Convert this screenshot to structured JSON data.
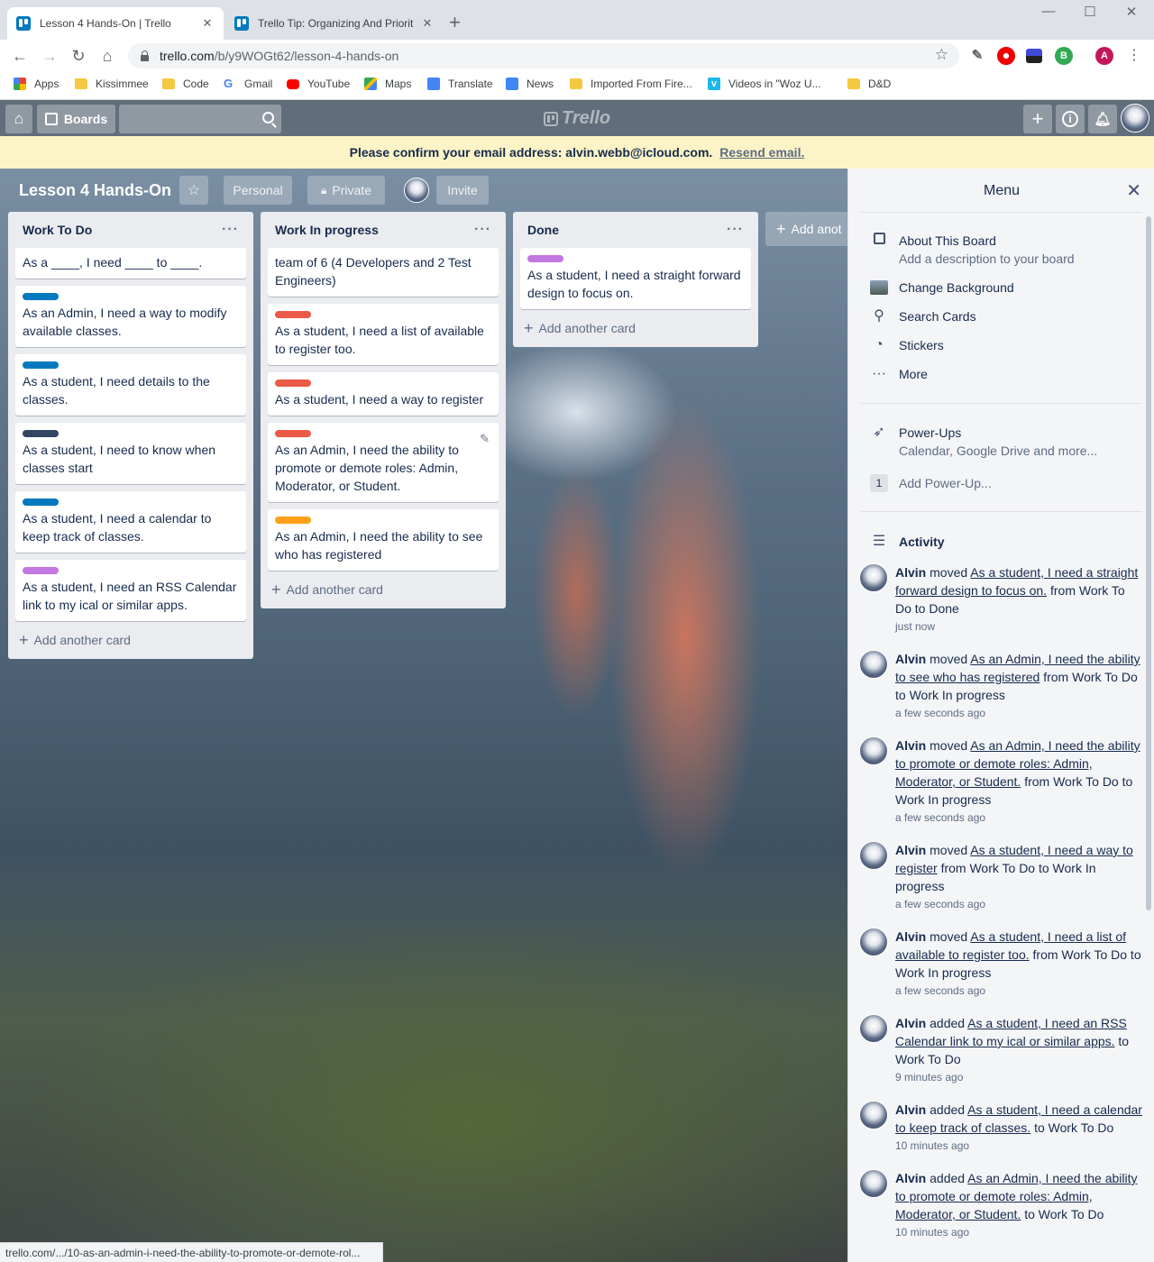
{
  "browser": {
    "tabs": [
      {
        "title": "Lesson 4 Hands-On | Trello",
        "active": true
      },
      {
        "title": "Trello Tip: Organizing And Priorit",
        "active": false
      }
    ],
    "url_domain": "trello.com",
    "url_path": "/b/y9WOGt62/lesson-4-hands-on",
    "bookmarks": [
      {
        "label": "Apps",
        "icon": "apps-grid-icon"
      },
      {
        "label": "Kissimmee",
        "icon": "folder-icon"
      },
      {
        "label": "Code",
        "icon": "folder-icon"
      },
      {
        "label": "Gmail",
        "icon": "google-icon"
      },
      {
        "label": "YouTube",
        "icon": "youtube-icon"
      },
      {
        "label": "Maps",
        "icon": "maps-icon"
      },
      {
        "label": "Translate",
        "icon": "translate-icon"
      },
      {
        "label": "News",
        "icon": "news-icon"
      },
      {
        "label": "Imported From Fire...",
        "icon": "folder-icon"
      },
      {
        "label": "Videos in \"Woz U...",
        "icon": "vimeo-icon"
      },
      {
        "label": "D&D",
        "icon": "folder-icon"
      }
    ],
    "profile_initial": "A",
    "status_url": "trello.com/.../10-as-an-admin-i-need-the-ability-to-promote-or-demote-rol..."
  },
  "header": {
    "boards_label": "Boards",
    "logo_text": "Trello"
  },
  "email_banner": {
    "message": "Please confirm your email address: alvin.webb@icloud.com.",
    "resend": "Resend email."
  },
  "board": {
    "title": "Lesson 4 Hands-On",
    "personal": "Personal",
    "private": "Private",
    "invite": "Invite",
    "add_list": "Add anot",
    "lists": [
      {
        "name": "Work To Do",
        "cards": [
          {
            "text": "As a ____, I need ____ to ____.",
            "label": null
          },
          {
            "text": "As an Admin, I need a way to modify available classes.",
            "label": "#0079bf"
          },
          {
            "text": "As a student, I need details to the classes.",
            "label": "#0079bf"
          },
          {
            "text": "As a student, I need to know when classes start",
            "label": "#344563"
          },
          {
            "text": "As a student, I need a calendar to keep track of classes.",
            "label": "#0079bf"
          },
          {
            "text": "As a student, I need an RSS Calendar link to my ical or similar apps.",
            "label": "#c377e0"
          }
        ],
        "add_card": "Add another card"
      },
      {
        "name": "Work In progress",
        "cards": [
          {
            "text": "team of 6 (4 Developers and 2 Test Engineers)",
            "label": null
          },
          {
            "text": "As a student, I need a list of available to register too.",
            "label": "#eb5a46"
          },
          {
            "text": "As a student, I need a way to register",
            "label": "#eb5a46"
          },
          {
            "text": "As an Admin, I need the ability to promote or demote roles: Admin, Moderator, or Student.",
            "label": "#eb5a46"
          },
          {
            "text": "As an Admin, I need the ability to see who has registered",
            "label": "#ff9f1a"
          }
        ],
        "add_card": "Add another card"
      },
      {
        "name": "Done",
        "cards": [
          {
            "text": "As a student, I need a straight forward design to focus on.",
            "label": "#c377e0"
          }
        ],
        "add_card": "Add another card"
      }
    ]
  },
  "menu": {
    "title": "Menu",
    "about_title": "About This Board",
    "about_sub": "Add a description to your board",
    "change_background": "Change Background",
    "search_cards": "Search Cards",
    "stickers": "Stickers",
    "more": "More",
    "powerups_title": "Power-Ups",
    "powerups_sub": "Calendar, Google Drive and more...",
    "powerup_count": "1",
    "add_powerup": "Add Power-Up...",
    "activity_title": "Activity",
    "activity": [
      {
        "who": "Alvin",
        "action": " moved ",
        "link": "As a student, I need a straight forward design to focus on.",
        "rest": " from Work To Do to Done",
        "time": "just now"
      },
      {
        "who": "Alvin",
        "action": " moved ",
        "link": "As an Admin, I need the ability to see who has registered",
        "rest": " from Work To Do to Work In progress",
        "time": "a few seconds ago"
      },
      {
        "who": "Alvin",
        "action": " moved ",
        "link": "As an Admin, I need the ability to promote or demote roles: Admin, Moderator, or Student.",
        "rest": " from Work To Do to Work In progress",
        "time": "a few seconds ago"
      },
      {
        "who": "Alvin",
        "action": " moved ",
        "link": "As a student, I need a way to register",
        "rest": " from Work To Do to Work In progress",
        "time": "a few seconds ago"
      },
      {
        "who": "Alvin",
        "action": " moved ",
        "link": "As a student, I need a list of available to register too.",
        "rest": " from Work To Do to Work In progress",
        "time": "a few seconds ago"
      },
      {
        "who": "Alvin",
        "action": " added ",
        "link": "As a student, I need an RSS Calendar link to my ical or similar apps.",
        "rest": " to Work To Do",
        "time": "9 minutes ago"
      },
      {
        "who": "Alvin",
        "action": " added ",
        "link": "As a student, I need a calendar to keep track of classes.",
        "rest": " to Work To Do",
        "time": "10 minutes ago"
      },
      {
        "who": "Alvin",
        "action": " added ",
        "link": "As an Admin, I need the ability to promote or demote roles: Admin, Moderator, or Student.",
        "rest": " to Work To Do",
        "time": "10 minutes ago"
      }
    ]
  }
}
